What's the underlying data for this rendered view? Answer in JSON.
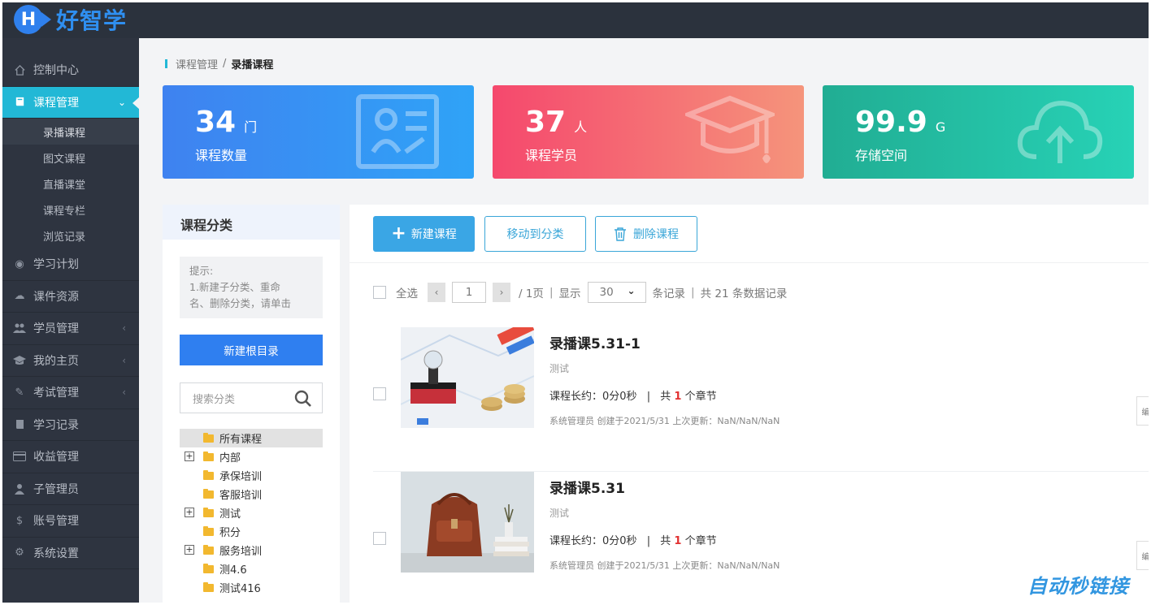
{
  "app": {
    "logo_letter": "H",
    "logo_text": "好智学"
  },
  "sidebar": {
    "items": [
      {
        "label": "控制中心",
        "icon": "home-icon"
      },
      {
        "label": "课程管理",
        "icon": "book-icon",
        "active": true
      },
      {
        "label": "学习计划",
        "icon": "eye-icon"
      },
      {
        "label": "课件资源",
        "icon": "cloud-icon"
      },
      {
        "label": "学员管理",
        "icon": "users-icon"
      },
      {
        "label": "我的主页",
        "icon": "mortarboard-icon"
      },
      {
        "label": "考试管理",
        "icon": "exam-icon"
      },
      {
        "label": "学习记录",
        "icon": "notebook-icon"
      },
      {
        "label": "收益管理",
        "icon": "credit-card-icon"
      },
      {
        "label": "子管理员",
        "icon": "user-icon"
      },
      {
        "label": "账号管理",
        "icon": "dollar-icon"
      },
      {
        "label": "系统设置",
        "icon": "gear-icon"
      }
    ],
    "sub_items": [
      "录播课程",
      "图文课程",
      "直播课堂",
      "课程专栏",
      "浏览记录"
    ]
  },
  "breadcrumb": {
    "parent": "课程管理",
    "separator": "/",
    "current": "录播课程"
  },
  "stats": [
    {
      "value": "34",
      "unit": "门",
      "label": "课程数量",
      "icon": "course-card-icon"
    },
    {
      "value": "37",
      "unit": "人",
      "label": "课程学员",
      "icon": "graduation-cap-icon"
    },
    {
      "value": "99.9",
      "unit": "G",
      "label": "存储空间",
      "icon": "cloud-upload-icon"
    }
  ],
  "category": {
    "title": "课程分类",
    "tip_line1": "提示:",
    "tip_line2": "1.新建子分类、重命",
    "tip_line3": "名、删除分类，请单击",
    "new_root_label": "新建根目录",
    "search_placeholder": "搜索分类",
    "tree": [
      {
        "label": "所有课程",
        "expandable": false,
        "selected": true
      },
      {
        "label": "内部",
        "expandable": true
      },
      {
        "label": "承保培训",
        "expandable": false
      },
      {
        "label": "客服培训",
        "expandable": false
      },
      {
        "label": "测试",
        "expandable": true
      },
      {
        "label": "积分",
        "expandable": false
      },
      {
        "label": "服务培训",
        "expandable": true
      },
      {
        "label": "测4.6",
        "expandable": false
      },
      {
        "label": "测试416",
        "expandable": false
      }
    ]
  },
  "toolbar": {
    "new_label": "新建课程",
    "move_label": "移动到分类",
    "delete_label": "删除课程"
  },
  "pager": {
    "select_all": "全选",
    "prev": "‹",
    "page": "1",
    "next": "›",
    "total_pages": "/ 1页",
    "sep": "|",
    "show": "显示",
    "page_size": "30",
    "records": "条记录",
    "total": "共 21 条数据记录"
  },
  "courses": [
    {
      "title": "录播课5.31-1",
      "desc": "测试",
      "duration": "课程长约：0分0秒",
      "chapters_prefix": "共",
      "chapters": "1",
      "chapters_suffix": "个章节",
      "info": "系统管理员 创建于2021/5/31 上次更新：NaN/NaN/NaN",
      "edit": "编"
    },
    {
      "title": "录播课5.31",
      "desc": "测试",
      "duration": "课程长约：0分0秒",
      "chapters_prefix": "共",
      "chapters": "1",
      "chapters_suffix": "个章节",
      "info": "系统管理员 创建于2021/5/31 上次更新：NaN/NaN/NaN",
      "edit": "编"
    }
  ],
  "watermark": "自动秒链接",
  "colors": {
    "sidebar_bg": "#2e3440",
    "accent": "#22b8d6",
    "primary": "#2f7ff0",
    "card_blue": "#3f82f0",
    "card_pink": "#f5486d",
    "card_green": "#21ad93"
  }
}
